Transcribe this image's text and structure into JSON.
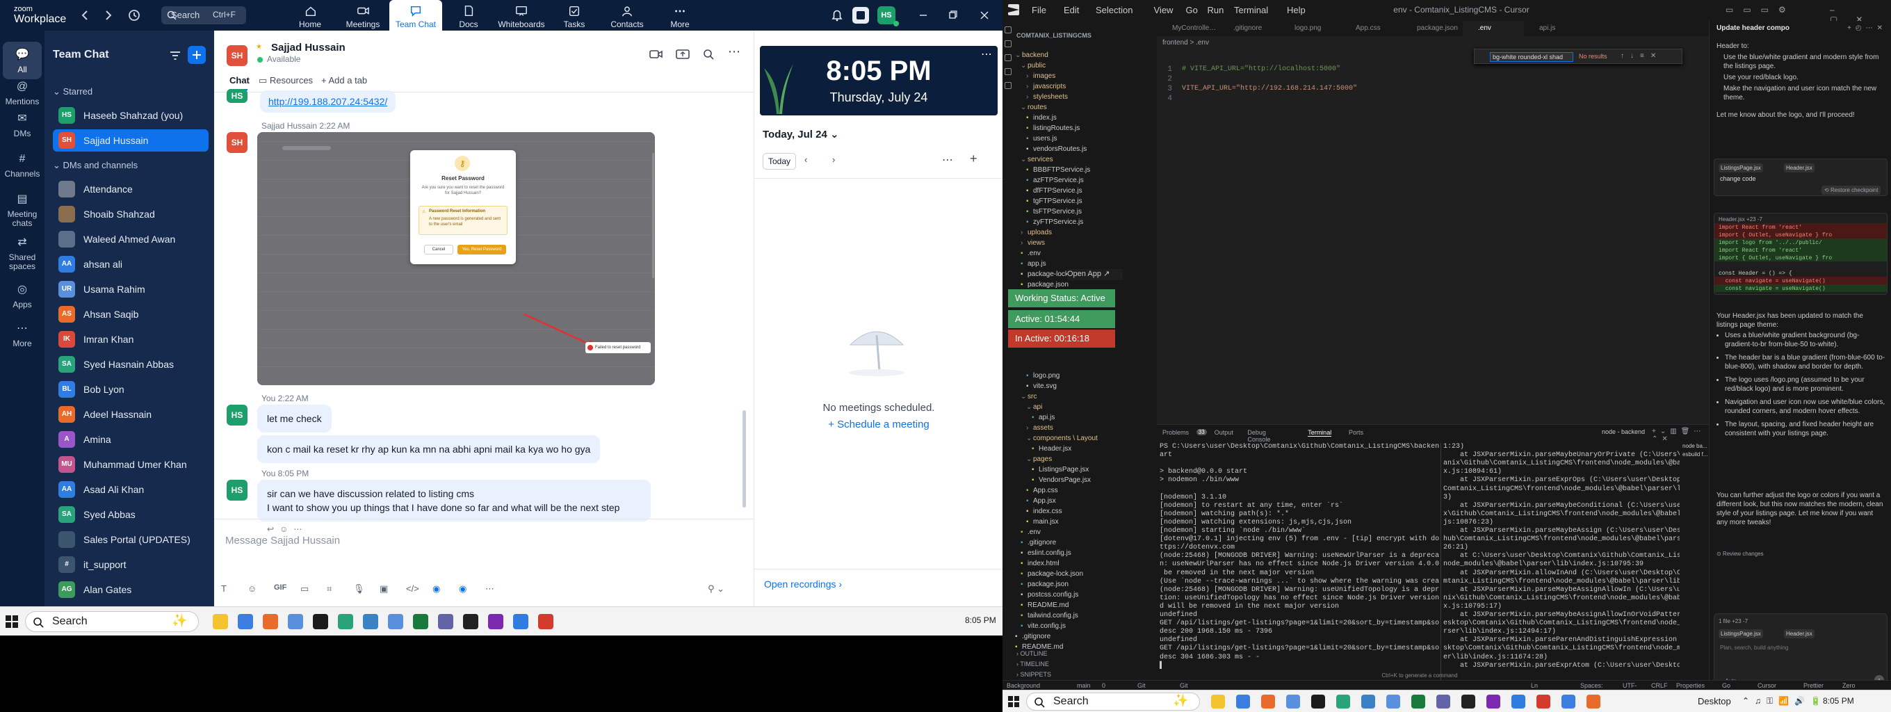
{
  "left_screen": {
    "zoom": {
      "logo_top": "zoom",
      "logo_bottom": "Workplace",
      "search": {
        "placeholder": "Search",
        "shortcut": "Ctrl+F"
      },
      "nav_tabs": [
        {
          "label": "Home",
          "icon": "home-icon"
        },
        {
          "label": "Meetings",
          "icon": "video-icon"
        },
        {
          "label": "Team Chat",
          "icon": "chat-icon",
          "active": true
        },
        {
          "label": "Docs",
          "icon": "docs-icon"
        },
        {
          "label": "Whiteboards",
          "icon": "whiteboard-icon"
        },
        {
          "label": "Tasks",
          "icon": "tasks-icon"
        },
        {
          "label": "Contacts",
          "icon": "contacts-icon"
        },
        {
          "label": "More",
          "icon": "more-icon"
        }
      ],
      "user_initials": "HS",
      "rail": [
        {
          "label": "All",
          "active": true
        },
        {
          "label": "Mentions"
        },
        {
          "label": "DMs"
        },
        {
          "label": "Channels"
        },
        {
          "label": "Meeting chats"
        },
        {
          "label": "Shared spaces"
        },
        {
          "label": "Apps"
        },
        {
          "label": "More"
        }
      ],
      "sidebar": {
        "title": "Team Chat",
        "starred_label": "Starred",
        "starred": [
          {
            "name": "Haseeb Shahzad (you)",
            "initials": "HS",
            "color": "#1c9f6a"
          },
          {
            "name": "Sajjad Hussain",
            "initials": "SH",
            "color": "#e0503a",
            "selected": true
          }
        ],
        "dms_label": "DMs and channels",
        "items": [
          {
            "name": "Attendance",
            "initials": "",
            "color": "#6f7b8d"
          },
          {
            "name": "Shoaib Shahzad",
            "initials": "",
            "color": "#8a6d4e"
          },
          {
            "name": "Waleed Ahmed Awan",
            "initials": "",
            "color": "#5b6e8a"
          },
          {
            "name": "ahsan ali",
            "initials": "AA",
            "color": "#2f7de0"
          },
          {
            "name": "Usama Rahim",
            "initials": "UR",
            "color": "#5a8fdd"
          },
          {
            "name": "Ahsan Saqib",
            "initials": "AS",
            "color": "#e86b2c"
          },
          {
            "name": "Imran Khan",
            "initials": "IK",
            "color": "#d94a3a"
          },
          {
            "name": "Syed Hasnain Abbas",
            "initials": "SA",
            "color": "#2aa27a"
          },
          {
            "name": "Bob Lyon",
            "initials": "BL",
            "color": "#2f7de0"
          },
          {
            "name": "Adeel Hassnain",
            "initials": "AH",
            "color": "#e86b2c"
          },
          {
            "name": "Amina",
            "initials": "A",
            "color": "#9a56c9"
          },
          {
            "name": "Muhammad Umer Khan",
            "initials": "MU",
            "color": "#c2548e"
          },
          {
            "name": "Asad Ali Khan",
            "initials": "AA",
            "color": "#2f7de0"
          },
          {
            "name": "Syed Abbas",
            "initials": "SA",
            "color": "#2aa27a"
          },
          {
            "name": "Sales Portal (UPDATES)",
            "initials": "",
            "color": "#3b556f"
          },
          {
            "name": "it_support",
            "initials": "#",
            "color": "#3b556f"
          },
          {
            "name": "Alan Gates",
            "initials": "AG",
            "color": "#3c9a5e"
          }
        ]
      },
      "chat": {
        "contact_name": "Sajjad Hussain",
        "contact_initials": "SH",
        "status": "Available",
        "tabs": [
          "Chat",
          "Resources",
          "Add a tab"
        ],
        "link_message": "http://199.188.207.24:5432/",
        "image_sender": "Sajjad Hussain  2:22 AM",
        "dialog": {
          "title": "Reset Password",
          "body": "Are you sure you want to reset the password for Sajjad Hussain?",
          "warning_title": "Password Reset Information",
          "warning_body": "A new password is generated and sent to the user's email",
          "cancel": "Cancel",
          "confirm": "Yes, Reset Password",
          "toast": "Failed to reset password"
        },
        "group1_time": "You  2:22 AM",
        "msg1": "let me check",
        "msg2": "kon c mail ka reset kr rhy ap kun ka mn na abhi apni mail ka kya wo ho gya",
        "group2_time": "You  8:05 PM",
        "msg3_line1": "sir can we have discussion related to listing cms",
        "msg3_line2": "I want to show you up things that I have done so far and what will be the next step",
        "composer_placeholder": "Message Sajjad Hussain",
        "gif_label": "GIF"
      },
      "calendar": {
        "time": "8:05 PM",
        "date": "Thursday, July 24",
        "day_label": "Today, Jul 24",
        "today_button": "Today",
        "empty": "No meetings scheduled.",
        "schedule": "Schedule a meeting",
        "recordings": "Open recordings"
      }
    },
    "taskbar": {
      "search": "Search",
      "time": "8:05 PM"
    }
  },
  "right_screen": {
    "cursor": {
      "menu": [
        "File",
        "Edit",
        "Selection",
        "View",
        "Go",
        "Run",
        "Terminal",
        "Help"
      ],
      "title": "env - Comtanix_ListingCMS - Cursor",
      "explorer_title": "COMTANIX_LISTINGCMS",
      "tree": [
        {
          "d": 0,
          "t": "backend",
          "f": true,
          "o": true
        },
        {
          "d": 1,
          "t": "public",
          "f": true,
          "o": true
        },
        {
          "d": 2,
          "t": "images",
          "f": true
        },
        {
          "d": 2,
          "t": "javascripts",
          "f": true
        },
        {
          "d": 2,
          "t": "stylesheets",
          "f": true
        },
        {
          "d": 1,
          "t": "routes",
          "f": true,
          "o": true
        },
        {
          "d": 2,
          "t": "index.js"
        },
        {
          "d": 2,
          "t": "listingRoutes.js"
        },
        {
          "d": 2,
          "t": "users.js"
        },
        {
          "d": 2,
          "t": "vendorsRoutes.js"
        },
        {
          "d": 1,
          "t": "services",
          "f": true,
          "o": true
        },
        {
          "d": 2,
          "t": "BBBFTPService.js"
        },
        {
          "d": 2,
          "t": "azFTPService.js"
        },
        {
          "d": 2,
          "t": "dfFTPService.js"
        },
        {
          "d": 2,
          "t": "tgFTPService.js"
        },
        {
          "d": 2,
          "t": "tsFTPService.js"
        },
        {
          "d": 2,
          "t": "zyFTPService.js"
        },
        {
          "d": 1,
          "t": "uploads",
          "f": true
        },
        {
          "d": 1,
          "t": "views",
          "f": true
        },
        {
          "d": 1,
          "t": ".env"
        },
        {
          "d": 1,
          "t": "app.js"
        },
        {
          "d": 1,
          "t": "package-lock.json"
        },
        {
          "d": 1,
          "t": "package.json"
        }
      ],
      "tree2": [
        {
          "d": 2,
          "t": "logo.png"
        },
        {
          "d": 2,
          "t": "vite.svg"
        },
        {
          "d": 1,
          "t": "src",
          "f": true,
          "o": true
        },
        {
          "d": 2,
          "t": "api",
          "f": true,
          "o": true
        },
        {
          "d": 3,
          "t": "api.js"
        },
        {
          "d": 2,
          "t": "assets",
          "f": true
        },
        {
          "d": 2,
          "t": "components \\ Layout",
          "f": true,
          "o": true
        },
        {
          "d": 3,
          "t": "Header.jsx"
        },
        {
          "d": 2,
          "t": "pages",
          "f": true,
          "o": true
        },
        {
          "d": 3,
          "t": "ListingsPage.jsx"
        },
        {
          "d": 3,
          "t": "VendorsPage.jsx"
        },
        {
          "d": 2,
          "t": "App.css"
        },
        {
          "d": 2,
          "t": "App.jsx"
        },
        {
          "d": 2,
          "t": "index.css"
        },
        {
          "d": 2,
          "t": "main.jsx"
        },
        {
          "d": 1,
          "t": ".env"
        },
        {
          "d": 1,
          "t": ".gitignore"
        },
        {
          "d": 1,
          "t": "eslint.config.js"
        },
        {
          "d": 1,
          "t": "index.html"
        },
        {
          "d": 1,
          "t": "package-lock.json"
        },
        {
          "d": 1,
          "t": "package.json"
        },
        {
          "d": 1,
          "t": "postcss.config.js"
        },
        {
          "d": 1,
          "t": "README.md"
        },
        {
          "d": 1,
          "t": "tailwind.config.js"
        },
        {
          "d": 1,
          "t": "vite.config.js"
        },
        {
          "d": 0,
          "t": ".gitignore"
        },
        {
          "d": 0,
          "t": "README.md"
        }
      ],
      "outline": [
        "OUTLINE",
        "TIMELINE",
        "SNIPPETS"
      ],
      "open_app": "Open App",
      "widget": {
        "status": "Working Status: Active",
        "active": "Active: 01:54:44",
        "inactive": "In Active: 00:16:18"
      },
      "editor_tabs": [
        "MyController.js",
        ".gitignore",
        "logo.png",
        "App.css",
        "package.json",
        ".env",
        "api.js"
      ],
      "breadcrumb": "frontend  >  .env",
      "find_text": "bg-white rounded-xl shad",
      "find_result": "No results",
      "code": [
        {
          "n": "1",
          "t": "# VITE_API_URL=\"http://localhost:5000\"",
          "c": true
        },
        {
          "n": "2",
          "t": ""
        },
        {
          "n": "3",
          "t": "VITE_API_URL=\"http://192.168.214.147:5000\""
        },
        {
          "n": "4",
          "t": ""
        }
      ],
      "panel_tabs": [
        "Problems",
        "Output",
        "Debug Console",
        "Terminal",
        "Ports"
      ],
      "problems_count": "33",
      "terminal_session": "node - backend",
      "term_left": [
        "PS C:\\Users\\user\\Desktop\\Comtanix\\Github\\Comtanix_ListingCMS\\backend> npm st",
        "art",
        "",
        "> backend@0.0.0 start",
        "> nodemon ./bin/www",
        "",
        "[nodemon] 3.1.10",
        "[nodemon] to restart at any time, enter `rs`",
        "[nodemon] watching path(s): *.*",
        "[nodemon] watching extensions: js,mjs,cjs,json",
        "[nodemon] starting `node ./bin/www`",
        "[dotenv@17.0.1] injecting env (5) from .env - [tip] encrypt with dotenvx: h",
        "ttps://dotenvx.com",
        "(node:25468) [MONGODB DRIVER] Warning: useNewUrlParser is a deprecated optio",
        "n: useNewUrlParser has no effect since Node.js Driver version 4.0.0 and will",
        " be removed in the next major version",
        "(Use `node --trace-warnings ...` to show where the warning was created)",
        "(node:25468) [MONGODB DRIVER] Warning: useUnifiedTopology is a deprecated op",
        "tion: useUnifiedTopology has no effect since Node.js Driver version 4.0.0 an",
        "d will be removed in the next major version",
        "undefined",
        "GET /api/listings/get-listings?page=1&limit=20&sort_by=timestamp&sort_order=",
        "desc 200 1968.150 ms - 7396",
        "undefined",
        "GET /api/listings/get-listings?page=1&limit=20&sort_by=timestamp&sort_order=",
        "desc 304 1686.303 ms - -",
        "▌"
      ],
      "term_right": [
        "1:23)",
        "    at JSXParserMixin.parseMaybeUnaryOrPrivate (C:\\Users\\user\\Desktop\\Com",
        "anix\\Github\\Comtanix_ListingCMS\\frontend\\node_modules\\@babel\\parser\\lib\\inde",
        "x.js:10894:61)",
        "    at JSXParserMixin.parseExprOps (C:\\Users\\user\\Desktop\\Comtanix\\Github\\",
        "Comtanix_ListingCMS\\frontend\\node_modules\\@babel\\parser\\lib\\index.js:10899:2",
        "3)",
        "    at JSXParserMixin.parseMaybeConditional (C:\\Users\\user\\Desktop\\Comtani",
        "x\\Github\\Comtanix_ListingCMS\\frontend\\node_modules\\@babel\\parser\\lib\\index.",
        "js:10876:23)",
        "    at JSXParserMixin.parseMaybeAssign (C:\\Users\\user\\Desktop\\Comtanix\\Git",
        "hub\\Comtanix_ListingCMS\\frontend\\node_modules\\@babel\\parser\\lib\\index.js:108",
        "26:21)",
        "    at C:\\Users\\user\\Desktop\\Comtanix\\Github\\Comtanix_ListingCMS\\frontend\\",
        "node_modules\\@babel\\parser\\lib\\index.js:10795:39",
        "    at JSXParserMixin.allowInAnd (C:\\Users\\user\\Desktop\\Comtanix\\Github\\Co",
        "mtanix_ListingCMS\\frontend\\node_modules\\@babel\\parser\\lib\\index.js:12427:12)",
        "    at JSXParserMixin.parseMaybeAssignAllowIn (C:\\Users\\user\\Desktop\\Comta",
        "nix\\Github\\Comtanix_ListingCMS\\frontend\\node_modules\\@babel\\parser\\lib\\inde",
        "x.js:10795:17)",
        "    at JSXParserMixin.parseMaybeAssignAllowInOrVoidPattern (C:\\Users\\user\\D",
        "esktop\\Comtanix\\Github\\Comtanix_ListingCMS\\frontend\\node_modules\\@babel\\pa",
        "rser\\lib\\index.js:12494:17)",
        "    at JSXParserMixin.parseParenAndDistinguishExpression (C:\\Users\\user\\De",
        "sktop\\Comtanix\\Github\\Comtanix_ListingCMS\\frontend\\node_modules\\@babel\\pars",
        "er\\lib\\index.js:11674:28)",
        "    at JSXParserMixin.parseExprAtom (C:\\Users\\user\\Desktop\\Comtanix\\Github\\"
      ],
      "term_hint": "Ctrl+K to generate a command",
      "term_list": [
        "node  ba...",
        "esbuild  f..."
      ],
      "chat": {
        "title": "Update header compo",
        "intro": [
          "Header to:",
          "Use the blue/white gradient and modern style from the listings page.",
          "Use your red/black logo.",
          "Make the navigation and user icon match the new theme.",
          "",
          "Let me know about the logo, and I'll proceed!"
        ],
        "file_chips": [
          "ListingsPage.jsx",
          "Header.jsx"
        ],
        "change_code": "change code",
        "restore": "Restore checkpoint",
        "diff_file": "Header.jsx  +23 -7",
        "diff": [
          {
            "t": "import React from 'react'",
            "k": "-"
          },
          {
            "t": "import { Outlet, useNavigate } fro",
            "k": "-"
          },
          {
            "t": "import logo from '../../public/",
            "k": "+"
          },
          {
            "t": "import React from 'react'",
            "k": "+"
          },
          {
            "t": "import { Outlet, useNavigate } fro",
            "k": "+"
          },
          {
            "t": "",
            "k": " "
          },
          {
            "t": "const Header = () => {",
            "k": " "
          },
          {
            "t": "  const navigate = useNavigate()",
            "k": "-"
          },
          {
            "t": "  const navigate = useNavigate()",
            "k": "+"
          }
        ],
        "summary_p1": "Your Header.jsx has been updated to match the listings page theme:",
        "bullets": [
          "Uses a blue/white gradient background (bg-gradient-to-br from-blue-50 to-white).",
          "The header bar is a blue gradient (from-blue-600 to-blue-800), with shadow and border for depth.",
          "The logo uses /logo.png (assumed to be your red/black logo) and is more prominent.",
          "Navigation and user icon now use white/blue colors, rounded corners, and modern hover effects.",
          "The layout, spacing, and fixed header height are consistent with your listings page."
        ],
        "summary_p2": "You can further adjust the logo or colors if you want a different look, but this now matches the modern, clean style of your listings page. Let me know if you want any more tweaks!",
        "review": "Review changes",
        "input_files": "1 file  +23 -7",
        "input_chips": [
          "ListingsPage.jsx",
          "Header.jsx"
        ],
        "input_placeholder": "Plan, search, build anything",
        "mode": "Auto"
      },
      "status_left": [
        "Background Agents",
        "main",
        "0  0  0",
        "Git Graph",
        "Git Lj"
      ],
      "status_right": [
        "Ln 4, Col 1",
        "Spaces: 2",
        "UTF-8",
        "CRLF",
        "Properties",
        "Go Live",
        "Cursor Tab",
        "Prettier",
        "Zero Tab"
      ]
    },
    "taskbar": {
      "search": "Search",
      "desktop": "Desktop",
      "time": "8:05 PM"
    }
  }
}
